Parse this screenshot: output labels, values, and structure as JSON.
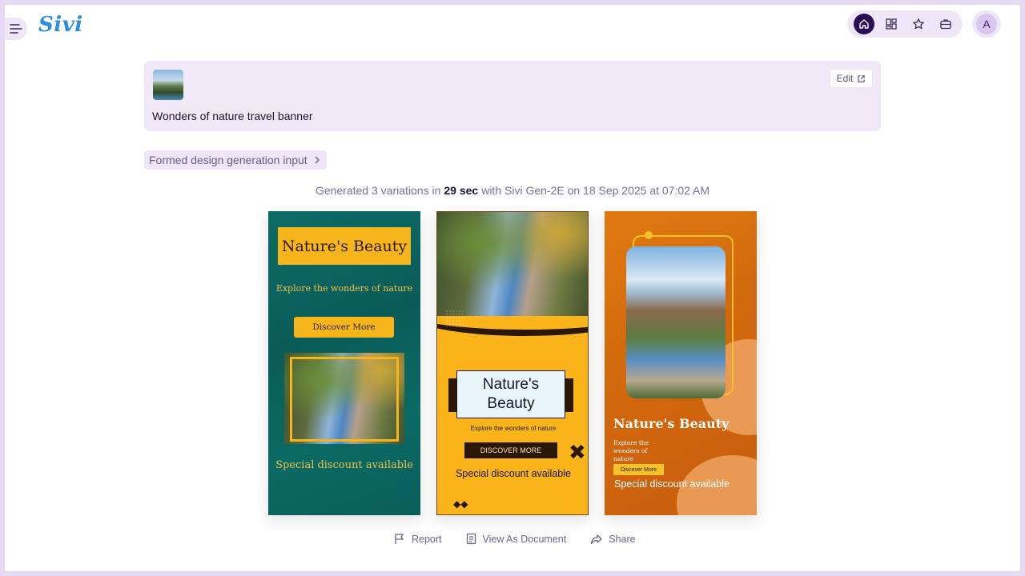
{
  "app": {
    "logo": "Sivi"
  },
  "prompt": {
    "text": "Wonders of nature travel banner",
    "edit_label": "Edit"
  },
  "formed_input_label": "Formed design generation input",
  "generation": {
    "prefix": "Generated 3 variations in",
    "duration": "29 sec",
    "suffix": "with Sivi Gen-2E  on 18 Sep 2025 at 07:02 AM"
  },
  "avatar_initial": "A",
  "designs": [
    {
      "title": "Nature's Beauty",
      "subtitle": "Explore the wonders of nature",
      "button": "Discover More",
      "discount": "Special discount available"
    },
    {
      "title": "Nature's Beauty",
      "subtitle": "Explore the wonders of nature",
      "button": "DISCOVER MORE",
      "discount": "Special discount available"
    },
    {
      "title": "Nature's Beauty",
      "subtitle": "Explore the wonders of nature",
      "button": "Discover More",
      "discount": "Special discount available"
    }
  ],
  "footer": {
    "report": "Report",
    "view_doc": "View As Document",
    "share": "Share"
  },
  "colors": {
    "accent": "#2a0d55",
    "teal": "#0c6b66",
    "yellow": "#fbb51b",
    "orange": "#d26a0e"
  }
}
